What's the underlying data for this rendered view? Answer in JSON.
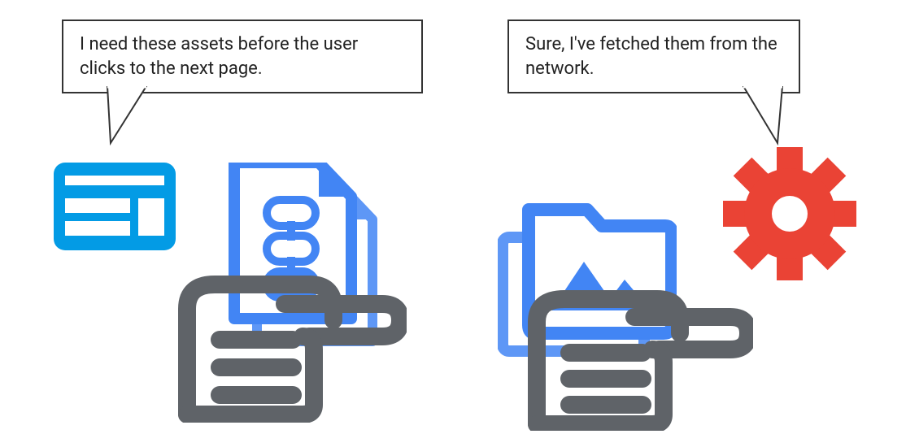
{
  "bubbles": {
    "left": "I need these assets before the user clicks to the next page.",
    "right": "Sure, I've fetched them from the network."
  },
  "icons": {
    "browser": "browser-window-icon",
    "document": "linked-document-icon",
    "hand_left": "hand-pointing-icon",
    "folder": "image-folder-icon",
    "hand_right": "hand-pointing-icon",
    "gear": "gear-icon"
  },
  "colors": {
    "blue_bright": "#039BE5",
    "blue_mid": "#4285F4",
    "blue_light": "#5E97F6",
    "red": "#EA4335",
    "gray": "#5F6368",
    "outline": "#333333",
    "white": "#FFFFFF"
  }
}
